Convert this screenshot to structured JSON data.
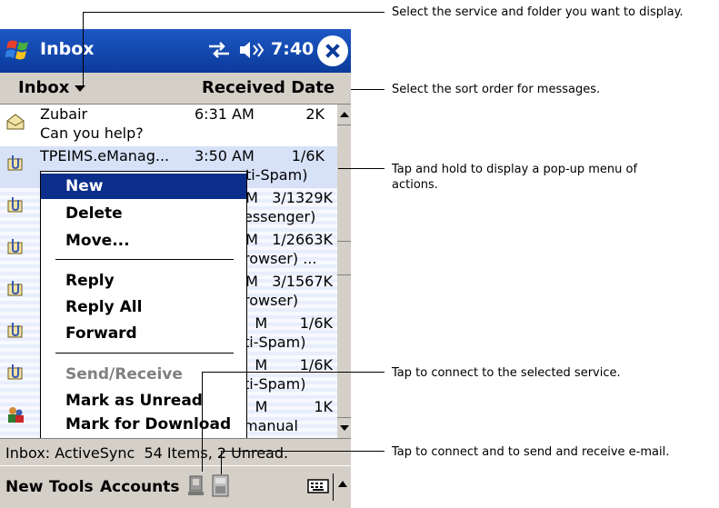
{
  "titlebar": {
    "title": "Inbox",
    "time": "7:40"
  },
  "folderbar": {
    "folder": "Inbox",
    "sort": "Received Date"
  },
  "messages": [
    {
      "from": "Zubair",
      "time": "6:31 AM",
      "size": "2K",
      "subject": "Can you help?",
      "icon": "open-envelope-icon"
    },
    {
      "from": "TPEIMS.eManag...",
      "time": "3:50 AM",
      "size": "1/6K",
      "subject": "ti-Spam)",
      "icon": "attachment-envelope-icon"
    },
    {
      "right_top": "M   3/1329K",
      "right_bottom": "essenger)",
      "icon": "attachment-envelope-icon"
    },
    {
      "right_top": "M   1/2663K",
      "right_bottom": "rowser) ...",
      "icon": "attachment-envelope-icon"
    },
    {
      "right_top": "M   3/1567K",
      "right_bottom": "rowser)",
      "icon": "attachment-envelope-icon"
    },
    {
      "right_top": "M       1/6K",
      "right_bottom": "ti-Spam)",
      "icon": "attachment-envelope-icon"
    },
    {
      "right_top": "M       1/6K",
      "right_bottom": "ti-Spam)",
      "icon": "attachment-envelope-icon"
    },
    {
      "right_top": "M          1K",
      "right_bottom": "manual",
      "icon": "people-icon"
    }
  ],
  "popup_menu": {
    "new": "New",
    "delete": "Delete",
    "move": "Move...",
    "reply": "Reply",
    "reply_all": "Reply All",
    "forward": "Forward",
    "send_receive": "Send/Receive",
    "mark_unread": "Mark as Unread",
    "mark_download": "Mark for Download"
  },
  "status": "Inbox: ActiveSync  54 Items, 2 Unread.",
  "menubar": {
    "new": "New",
    "tools": "Tools",
    "accounts": "Accounts"
  },
  "callouts": {
    "service": "Select the service and folder you want to display.",
    "sort": "Select the sort order for messages.",
    "hold_line1": "Tap and hold to display a pop-up menu of",
    "hold_line2": "actions.",
    "connect": "Tap to connect to the selected service.",
    "send_receive": "Tap to connect and to send and receive e-mail."
  },
  "colors": {
    "titlebar": "#0b3a9a",
    "highlight": "#0b2e8a",
    "chrome": "#d4d0c8"
  }
}
